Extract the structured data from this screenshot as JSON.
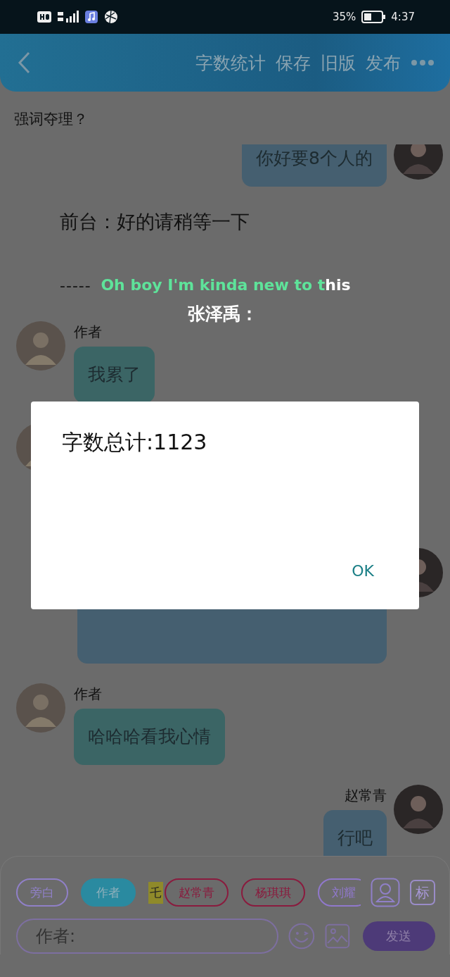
{
  "status_bar": {
    "battery": "35%",
    "time": "4:37"
  },
  "header": {
    "actions": [
      {
        "label": "字数统计"
      },
      {
        "label": "保存"
      },
      {
        "label": "旧版"
      },
      {
        "label": "发布"
      }
    ]
  },
  "title": "强词夺理？",
  "chat": [
    {
      "kind": "message_right",
      "text": "你好要8个人的"
    },
    {
      "kind": "narration",
      "text": "前台：好的请稍等一下"
    },
    {
      "kind": "divider",
      "text": "-----"
    },
    {
      "kind": "message_left",
      "name": "作者",
      "text": "我累了"
    },
    {
      "kind": "message_left"
    },
    {
      "kind": "message_right"
    },
    {
      "kind": "message_left",
      "name": "作者",
      "text": "哈哈哈看我心情"
    },
    {
      "kind": "message_right",
      "name": "赵常青",
      "text": "行吧"
    }
  ],
  "caption": {
    "sung": "Oh boy I'm kinda new to t",
    "unsung": "his",
    "line2": "张泽禹："
  },
  "roles": [
    {
      "label": "旁白",
      "color": "#9080c8",
      "selected": false
    },
    {
      "label": "作者",
      "color": "#2a8aa0",
      "selected": true
    },
    {
      "label": "赵常青",
      "color": "#8a1b3e",
      "selected": false,
      "tag": "乇"
    },
    {
      "label": "杨琪琪",
      "color": "#8a1b3e",
      "selected": false
    },
    {
      "label": "刘耀",
      "color": "#9078cc",
      "selected": false
    }
  ],
  "tag_button": "标",
  "input": {
    "value": "作者:"
  },
  "send": "发送",
  "dialog": {
    "message": "字数总计:1123",
    "button": "OK"
  }
}
